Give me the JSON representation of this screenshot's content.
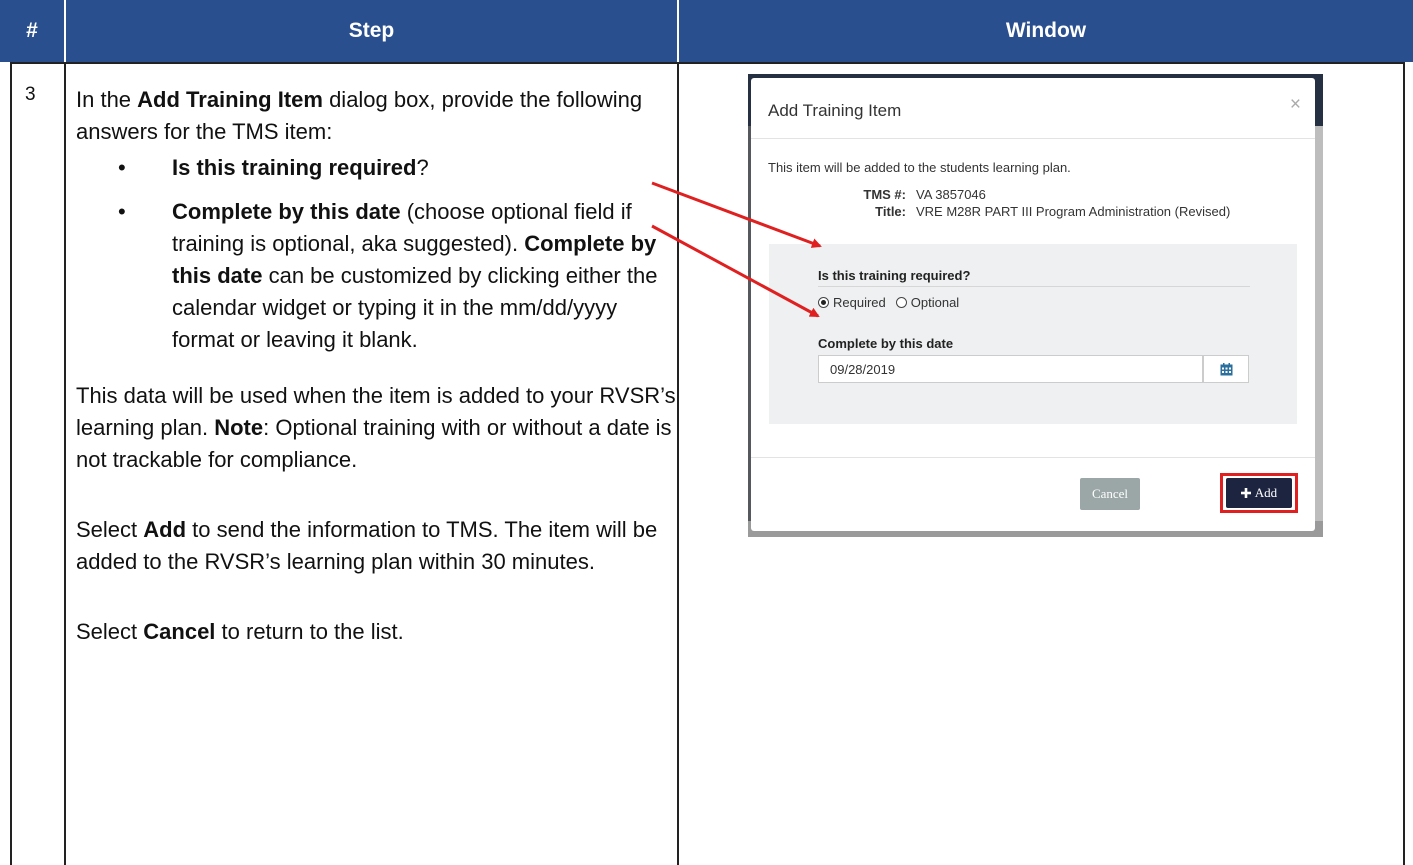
{
  "header": {
    "num": "#",
    "step": "Step",
    "window": "Window"
  },
  "step": {
    "number": "3",
    "intro_pre": "In the ",
    "intro_bold": "Add Training Item",
    "intro_post": " dialog box, provide the following answers for the TMS item:",
    "bullet1_bold": "Is this training required",
    "bullet1_post": "?",
    "bullet2_bold": "Complete by this date",
    "bullet2_mid": " (choose optional field if training is optional, aka suggested). ",
    "bullet2_bold2": "Complete by this date",
    "bullet2_post": " can be customized by clicking either the calendar widget or typing it in the mm/dd/yyyy format or leaving it blank.",
    "para1_pre": "This data will be used when the item is added to your RVSR’s learning plan. ",
    "para1_bold": "Note",
    "para1_post": ": Optional training with or without a date is not trackable for compliance.",
    "para2_pre": "Select ",
    "para2_bold": "Add",
    "para2_post": " to send the information to TMS. The item will be added to the RVSR’s learning plan within 30 minutes.",
    "para3_pre": "Select ",
    "para3_bold": "Cancel",
    "para3_post": " to return to the list."
  },
  "dialog": {
    "title": "Add Training Item",
    "close": "×",
    "intro": "This item will be added to the students learning plan.",
    "tms_label": "TMS #:",
    "tms_value": "VA 3857046",
    "title_label": "Title:",
    "title_value": "VRE M28R PART III Program Administration (Revised)",
    "question": "Is this training required?",
    "radio_required": "Required",
    "radio_optional": "Optional",
    "selected": "Required",
    "date_label": "Complete by this date",
    "date_value": "09/28/2019",
    "calendar_icon": "calendar-icon",
    "cancel": "Cancel",
    "add": "Add",
    "add_icon": "plus-icon"
  },
  "colors": {
    "header_bg": "#2a4f8f",
    "arrow": "#e02020",
    "add_button": "#1c2440",
    "cancel_button": "#9ba6a6"
  }
}
